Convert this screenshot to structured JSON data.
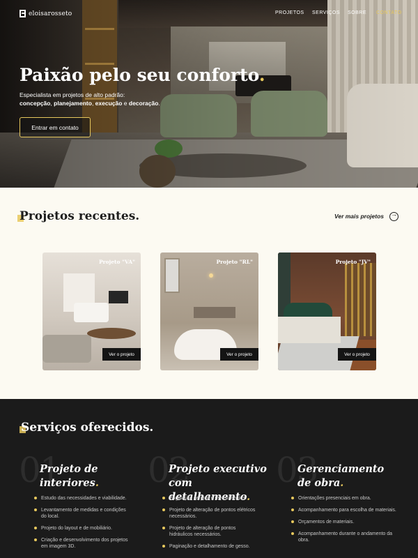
{
  "nav": {
    "logo": "eloisarosseto",
    "items": [
      "PROJETOS",
      "SERVIÇOS",
      "SOBRE",
      "CONTATO"
    ]
  },
  "hero": {
    "title": "Paixão pelo seu conforto",
    "title_dot": ".",
    "subtitle": "Especialista em projetos de alto padrão:",
    "keywords": [
      "concepção",
      "planejamento",
      "execução",
      "decoração"
    ],
    "cta": "Entrar em contato"
  },
  "projects": {
    "title": "Projetos recentes.",
    "more": "Ver mais projetos",
    "cards": [
      {
        "name": "Projeto \"VA\"",
        "button": "Ver o projeto"
      },
      {
        "name": "Projeto \"RL\"",
        "button": "Ver o projeto"
      },
      {
        "name": "Projeto \"JV\"",
        "button": "Ver o projeto"
      }
    ]
  },
  "services": {
    "title": "Serviços oferecidos.",
    "items": [
      {
        "number": "01",
        "title_line1": "Projeto de",
        "title_line2": "interiores",
        "bullets": [
          "Estudo das necessidades e viabilidade.",
          "Levantamento de medidas e condições do local.",
          "Projeto do layout e de mobiliário.",
          "Criação e desenvolvimento dos projetos em imagem 3D."
        ]
      },
      {
        "number": "02",
        "title_line1": "Projeto executivo",
        "title_line2": "com detalhamento",
        "bullets": [
          "Paginação de piso e revestimentos.",
          "Projeto de alteração de pontos elétricos necessários.",
          "Projeto de alteração de pontos hidráulicos necessários.",
          "Paginação e detalhamento de gesso."
        ]
      },
      {
        "number": "03",
        "title_line1": "Gerenciamento",
        "title_line2": "de obra",
        "bullets": [
          "Orientações presenciais em obra.",
          "Acompanhamento para escolha de materiais.",
          "Orçamentos de materiais.",
          "Acompanhamento durante o andamento da obra."
        ]
      }
    ]
  },
  "colors": {
    "accent": "#e7c85d",
    "dark": "#1b1b1b",
    "cream": "#fcfaf2"
  }
}
